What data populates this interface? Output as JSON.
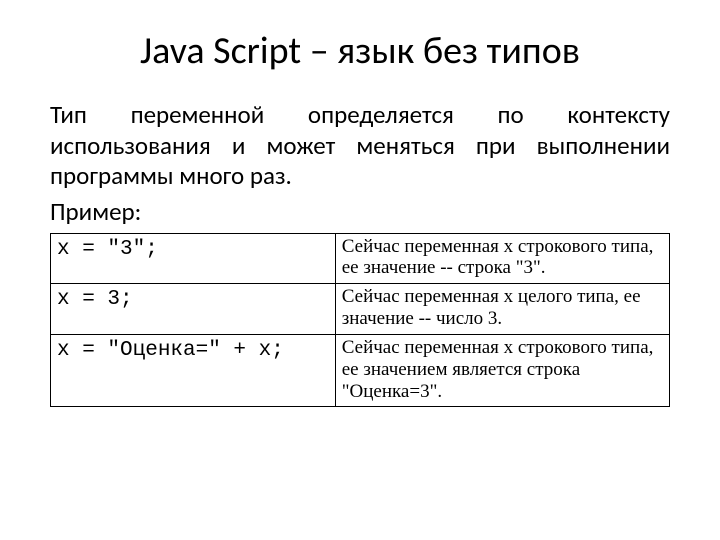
{
  "title": "Java Script – язык без типов",
  "paragraph": "Тип переменной определяется по контексту использования и может меняться при выполнении программы много раз.",
  "example_label": "Пример:",
  "rows": [
    {
      "code": "x = \"3\";",
      "desc": "Сейчас переменная x строкового типа, ее значение -- строка \"3\"."
    },
    {
      "code": "x = 3;",
      "desc": "Сейчас переменная x целого типа, ее значение -- число 3."
    },
    {
      "code": "x = \"Оценка=\" + x;",
      "desc": "Сейчас переменная x строкового типа, ее значением является строка \"Оценка=3\"."
    }
  ]
}
